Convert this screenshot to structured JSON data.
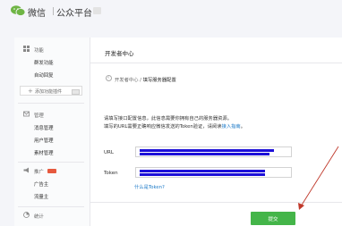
{
  "header": {
    "brand": "微信",
    "platform": "公众平台"
  },
  "sidebar": {
    "groups": [
      {
        "label": "功能",
        "icon": "grid-icon",
        "items": [
          "群发功能",
          "自动回复"
        ]
      },
      {
        "add_button": "添加功能插件"
      },
      {
        "label": "管理",
        "icon": "envelope-icon",
        "items": [
          "消息管理",
          "用户管理",
          "素材管理"
        ]
      },
      {
        "label": "推广",
        "icon": "megaphone-icon",
        "items": [
          "广告主",
          "流量主"
        ]
      },
      {
        "label": "统计",
        "icon": "chart-icon",
        "items": []
      }
    ]
  },
  "main": {
    "title": "开发者中心",
    "breadcrumb": {
      "parent": "开发者中心",
      "separator": " / ",
      "current": "填写服务器配置"
    },
    "notice": {
      "line1": "请填写接口配置信息，此信息需要你拥有自己的服务器资源。",
      "line2_prefix": "填写的URL需要正确响应微信发送的Token验证，请阅读",
      "line2_link": "接入指南",
      "line2_suffix": "。"
    },
    "form": {
      "url_label": "URL",
      "url_value": "",
      "token_label": "Token",
      "token_value": "",
      "token_help": "什么是Token?"
    },
    "submit_label": "提交"
  },
  "colors": {
    "accent_green": "#44b549",
    "link_blue": "#1e7bc8",
    "redaction_blue": "#1d10d8",
    "annotation_red": "#c0392b"
  }
}
